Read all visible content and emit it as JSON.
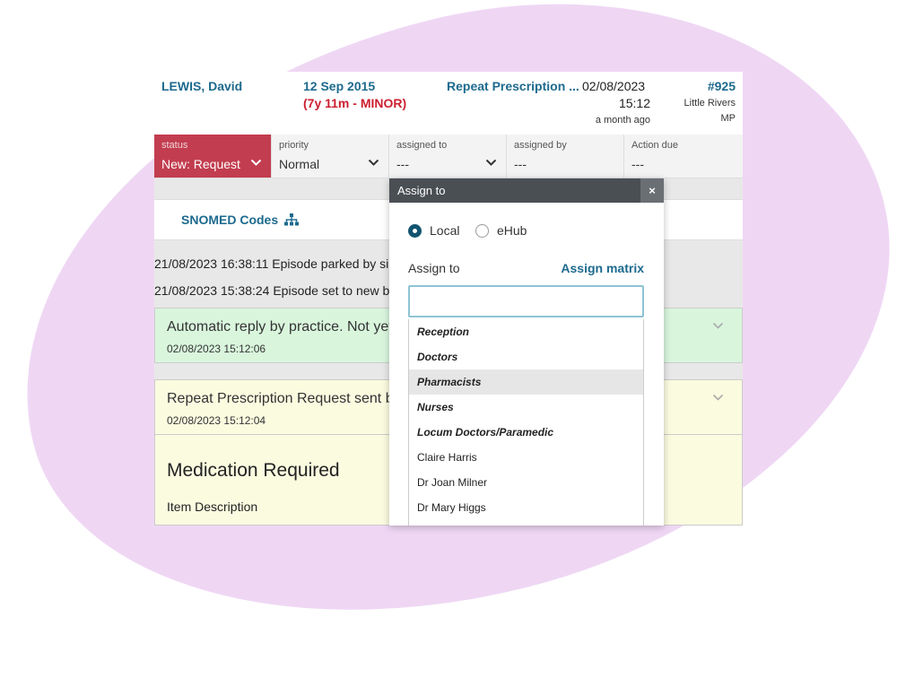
{
  "header": {
    "patient_name": "LEWIS, David",
    "dob": "12 Sep 2015",
    "age": "(7y 11m - MINOR)",
    "request_type": "Repeat Prescription ...",
    "date": "02/08/2023",
    "time": "15:12",
    "relative": "a month ago",
    "ref": "#925",
    "practice_line1": "Little Rivers",
    "practice_line2": "MP"
  },
  "fields": {
    "status_label": "status",
    "status_value": "New: Request",
    "priority_label": "priority",
    "priority_value": "Normal",
    "assigned_to_label": "assigned to",
    "assigned_to_value": "---",
    "assigned_by_label": "assigned by",
    "assigned_by_value": "---",
    "action_due_label": "Action due",
    "action_due_value": "---"
  },
  "snomed": {
    "label": "SNOMED Codes"
  },
  "log": {
    "line1": "21/08/2023 16:38:11 Episode parked by si",
    "line2": "21/08/2023 15:38:24 Episode set to new b"
  },
  "cards": {
    "auto_title": "Automatic reply by practice. Not yet",
    "auto_ts": "02/08/2023 15:12:06",
    "repeat_title": "Repeat Prescription Request sent by",
    "repeat_ts": "02/08/2023 15:12:04"
  },
  "medication": {
    "heading": "Medication Required",
    "item_label": "Item Description"
  },
  "popup": {
    "title": "Assign to",
    "close": "×",
    "radio_local": "Local",
    "radio_ehub": "eHub",
    "assign_to_label": "Assign to",
    "assign_matrix": "Assign matrix",
    "search_value": "",
    "options": [
      "Reception",
      "Doctors",
      "Pharmacists",
      "Nurses",
      "Locum Doctors/Paramedic",
      "Claire Harris",
      "Dr Joan Milner",
      "Dr Mary Higgs"
    ]
  },
  "colors": {
    "status_bg": "#c23d4f",
    "brand_blue": "#1d6a8e",
    "minor_red": "#cc1f2f",
    "auto_reply_bg": "#d9f6dd",
    "request_bg": "#fbfbe0",
    "backdrop_blob": "#efd7f4"
  }
}
